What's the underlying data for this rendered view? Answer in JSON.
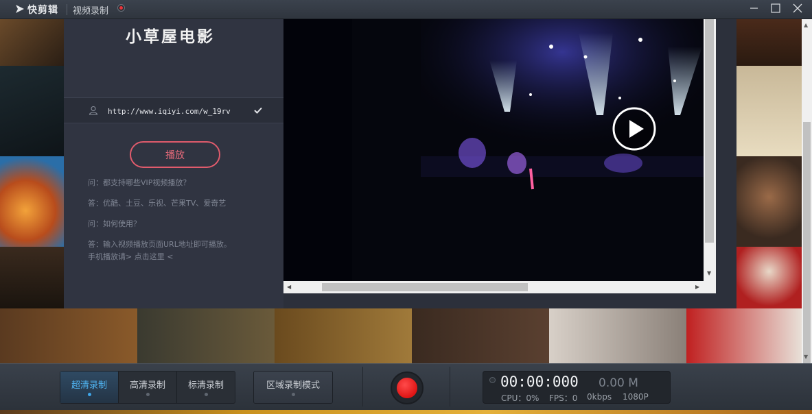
{
  "window": {
    "app_name": "快剪辑",
    "mode_title": "视频录制"
  },
  "site": {
    "brand": "小草屋电影",
    "url_value": "http://www.iqiyi.com/w_19rv",
    "play_label": "播放",
    "faq": [
      "问：都支持哪些VIP视频播放？",
      "答：优酷、土豆、乐视、芒果TV、爱奇艺",
      "问：如何使用？",
      "答：输入视频播放页面URL地址即可播放。",
      "手机播放请> 点击这里 <"
    ]
  },
  "toolbar": {
    "quality_options": [
      {
        "label": "超清录制",
        "selected": true
      },
      {
        "label": "高清录制",
        "selected": false
      },
      {
        "label": "标清录制",
        "selected": false
      }
    ],
    "region_mode_label": "区域录制模式",
    "record_icon": "record-icon"
  },
  "stats": {
    "timer": "00:00:000",
    "size": "0.00 M",
    "cpu": "CPU：0%",
    "fps": "FPS：0",
    "bitrate": "0kbps",
    "resolution": "1080P"
  },
  "colors": {
    "accent_blue": "#4fb2ef",
    "play_button": "#e05b6c",
    "record_red": "#e01515"
  }
}
